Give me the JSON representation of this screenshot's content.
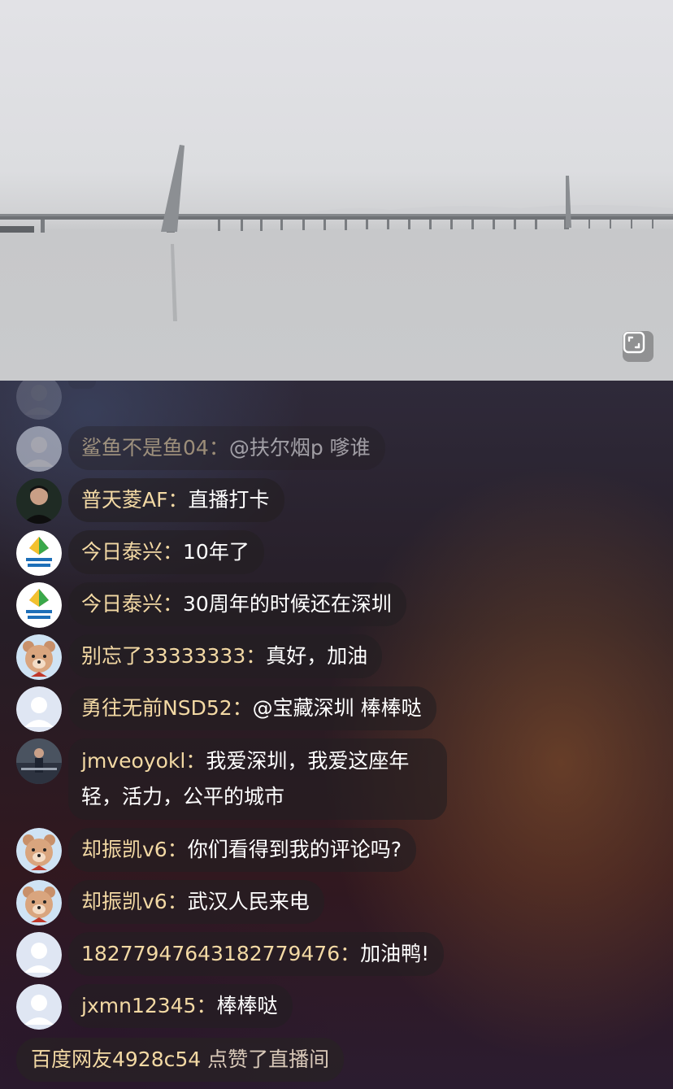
{
  "video": {
    "scene": "bridge-over-water",
    "fullscreen_icon": "fullscreen-icon"
  },
  "chat": {
    "messages": [
      {
        "user": "",
        "text": "",
        "avatar": "default-avatar",
        "state": "scrolled-off"
      },
      {
        "user": "鲨鱼不是鱼04",
        "text": "@扶尔烟p 嗲谁",
        "avatar": "default-avatar"
      },
      {
        "user": "普天菱AF",
        "text": "直播打卡",
        "avatar": "photo-avatar"
      },
      {
        "user": "今日泰兴",
        "text": "10年了",
        "avatar": "kite-logo-avatar"
      },
      {
        "user": "今日泰兴",
        "text": "30周年的时候还在深圳",
        "avatar": "kite-logo-avatar"
      },
      {
        "user": "别忘了33333333",
        "text": "真好，加油",
        "avatar": "bear-avatar"
      },
      {
        "user": "勇往无前NSD52",
        "text": "@宝藏深圳 棒棒哒",
        "avatar": "default-avatar"
      },
      {
        "user": "jmveoyokl",
        "text": "我爱深圳，我爱这座年轻，活力，公平的城市",
        "avatar": "photo-avatar"
      },
      {
        "user": "却振凯v6",
        "text": "你们看得到我的评论吗?",
        "avatar": "bear-avatar"
      },
      {
        "user": "却振凯v6",
        "text": "武汉人民来电",
        "avatar": "bear-avatar"
      },
      {
        "user": "18277947643182779476",
        "text": "加油鸭!",
        "avatar": "default-avatar"
      },
      {
        "user": "jxmn12345",
        "text": "棒棒哒",
        "avatar": "default-avatar"
      }
    ],
    "separator": "：",
    "notice": {
      "user": "百度网友4928c54",
      "action": "点赞了直播间"
    }
  },
  "colors": {
    "username": "#f3d9a4",
    "message_text": "#ffffff",
    "bubble_bg": "rgba(35,30,34,0.62)"
  }
}
